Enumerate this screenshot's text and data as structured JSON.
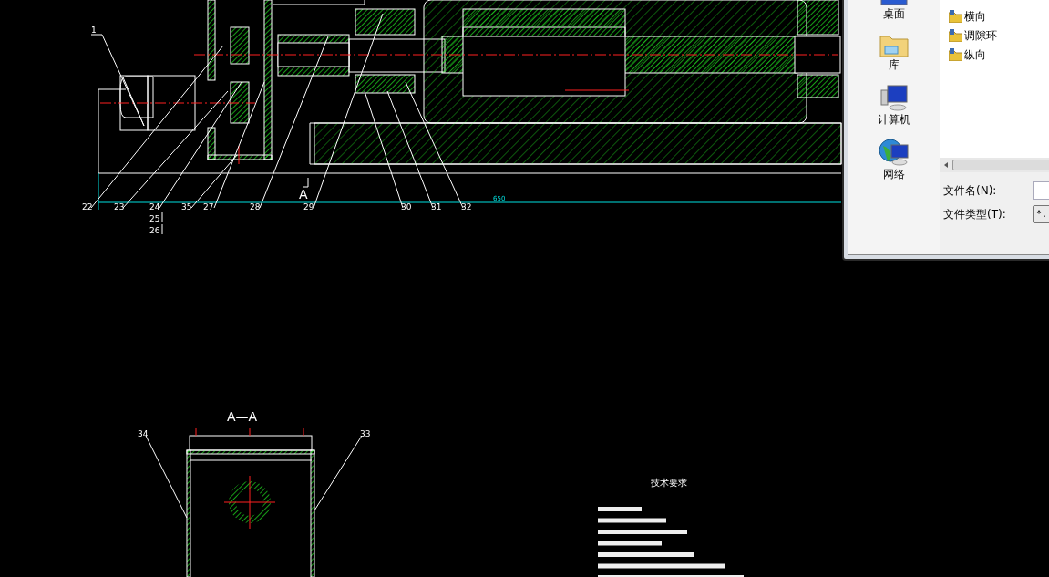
{
  "drawing": {
    "callouts": [
      {
        "label": "1"
      },
      {
        "label": "22"
      },
      {
        "label": "23"
      },
      {
        "label": "24"
      },
      {
        "label": "25"
      },
      {
        "label": "26"
      },
      {
        "label": "35"
      },
      {
        "label": "27"
      },
      {
        "label": "28"
      },
      {
        "label": "29"
      },
      {
        "label": "30"
      },
      {
        "label": "31"
      },
      {
        "label": "32"
      },
      {
        "label": "34"
      },
      {
        "label": "33"
      }
    ],
    "dimension": "650",
    "section_mark": "A",
    "section_title": "A—A",
    "requirements_title": "技术要求"
  },
  "dialog": {
    "places": [
      {
        "label": "桌面",
        "kind": "desktop"
      },
      {
        "label": "库",
        "kind": "library"
      },
      {
        "label": "计算机",
        "kind": "computer"
      },
      {
        "label": "网络",
        "kind": "network"
      }
    ],
    "files": [
      {
        "name": "横向"
      },
      {
        "name": "调隙环"
      },
      {
        "name": "纵向"
      }
    ],
    "file_name": {
      "label": "文件名(N):"
    },
    "file_type": {
      "label": "文件类型(T):",
      "value": "*."
    }
  }
}
